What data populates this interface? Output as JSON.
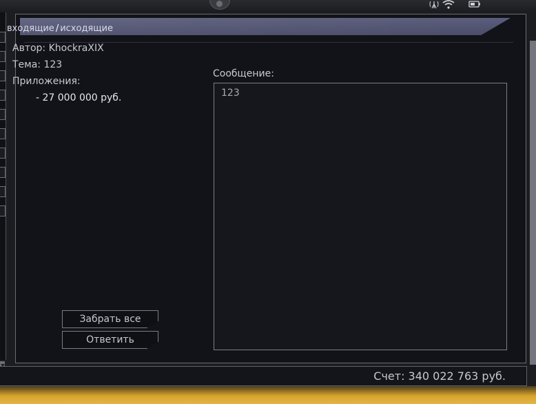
{
  "header": {
    "tab_incoming": "входящие",
    "separator": "/",
    "tab_outgoing": "исходящие"
  },
  "mail": {
    "author_label": "Автор:",
    "author_value": "KhockraXIX",
    "subject_label": "Тема:",
    "subject_value": "123",
    "attachments_label": "Приложения:",
    "attachments": [
      "- 27 000 000 руб."
    ],
    "message_label": "Сообщение:",
    "message_text": "123"
  },
  "buttons": {
    "take_all": "Забрать все",
    "reply": "Ответить"
  },
  "footer": {
    "account_text": "Счет: 340 022 763 руб."
  },
  "status_icons": [
    "antenna-icon",
    "wifi-icon",
    "battery-icon"
  ]
}
